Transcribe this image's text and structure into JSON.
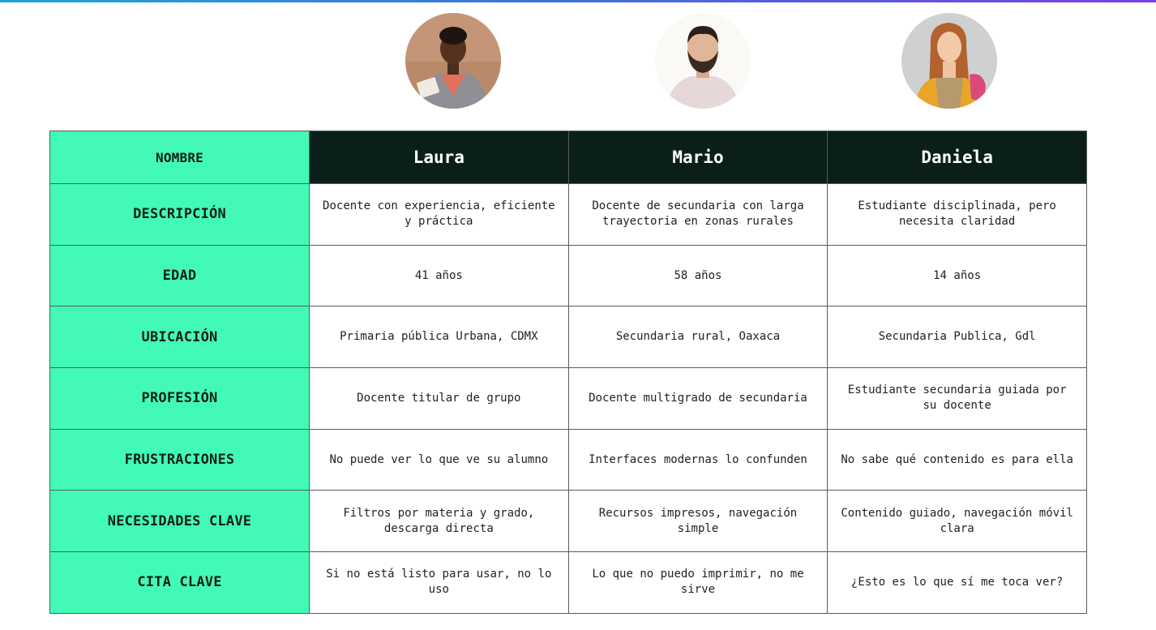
{
  "personas": [
    {
      "name": "Laura",
      "description": "Docente con experiencia, eficiente y práctica",
      "age": "41 años",
      "location": "Primaria pública Urbana, CDMX",
      "profession": "Docente titular de grupo",
      "frustrations": "No puede ver lo que ve su alumno",
      "needs": "Filtros por materia y grado, descarga directa",
      "quote": "Si no está listo para usar, no lo uso"
    },
    {
      "name": "Mario",
      "description": "Docente de secundaria con larga trayectoria en zonas rurales",
      "age": "58 años",
      "location": "Secundaria rural, Oaxaca",
      "profession": "Docente multigrado de secundaria",
      "frustrations": "Interfaces modernas lo confunden",
      "needs": "Recursos impresos, navegación simple",
      "quote": "Lo que no puedo imprimir, no me sirve"
    },
    {
      "name": "Daniela",
      "description": "Estudiante disciplinada, pero necesita claridad",
      "age": "14 años",
      "location": "Secundaria Publica, Gdl",
      "profession": "Estudiante secundaria guiada por su docente",
      "frustrations": "No sabe qué contenido es para ella",
      "needs": "Contenido guiado, navegación móvil clara",
      "quote": "¿Esto es lo que sí me toca ver?"
    }
  ],
  "labels": {
    "name": "NOMBRE",
    "description": "DESCRIPCIÓN",
    "age": "EDAD",
    "location": "UBICACIÓN",
    "profession": "PROFESIÓN",
    "frustrations": "FRUSTRACIONES",
    "needs": "NECESIDADES CLAVE",
    "quote": "CITA CLAVE"
  },
  "colors": {
    "label_bg": "#42fab5",
    "header_bg": "#0a1f1a",
    "border": "#5b5b5b"
  }
}
